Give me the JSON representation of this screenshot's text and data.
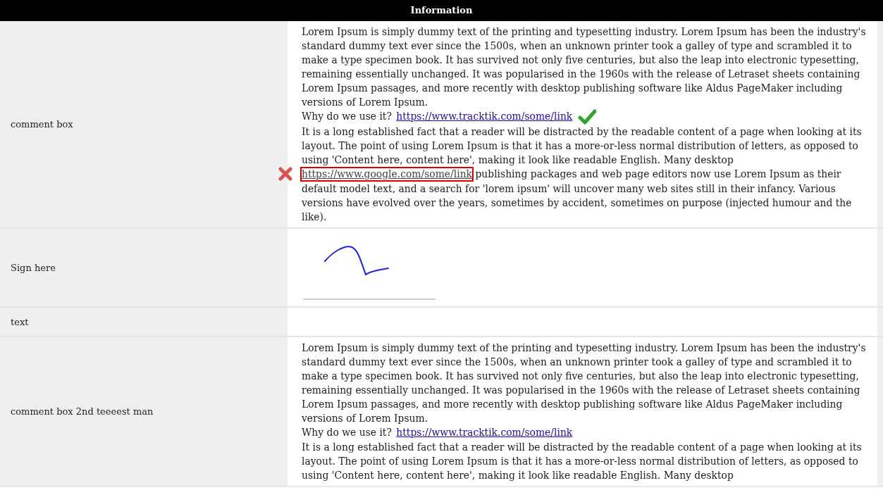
{
  "header": {
    "title": "Information"
  },
  "rows": [
    {
      "kind": "comment",
      "label": "comment box",
      "blocks": [
        [
          {
            "kind": "text",
            "text": "Lorem Ipsum is simply dummy text of the printing and typesetting industry. Lorem Ipsum has been the industry's standard dummy text ever since the 1500s, when an unknown printer took a galley of type and scrambled it to make a type specimen book. It has survived not only five centuries, but also the leap into electronic typesetting, remaining essentially unchanged. It was popularised in the 1960s with the release of Letraset sheets containing Lorem Ipsum passages, and more recently with desktop publishing software like Aldus PageMaker including versions of Lorem Ipsum."
          }
        ],
        [
          {
            "kind": "text",
            "text": "Why do we use it? "
          },
          {
            "kind": "link",
            "text": "https://www.tracktik.com/some/link",
            "verified": true,
            "flagged": false
          }
        ],
        [
          {
            "kind": "text",
            "text": "It is a long established fact that a reader will be distracted by the readable content of a page when looking at its layout. The point of using Lorem Ipsum is that it has a more-or-less normal distribution of letters, as opposed to using 'Content here, content here', making it look like readable English. Many desktop "
          },
          {
            "kind": "link",
            "text": "https://www.google.com/some/link",
            "verified": false,
            "flagged": true
          },
          {
            "kind": "text",
            "text": " publishing packages and web page editors now use Lorem Ipsum as their default model text, and a search for 'lorem ipsum' will uncover many web sites still in their infancy. Various versions have evolved over the years, sometimes by accident, sometimes on purpose (injected humour and the like)."
          }
        ]
      ]
    },
    {
      "kind": "signature",
      "label": "Sign here"
    },
    {
      "kind": "text",
      "label": "text"
    },
    {
      "kind": "comment",
      "label": "comment box 2nd teeeest man",
      "blocks": [
        [
          {
            "kind": "text",
            "text": "Lorem Ipsum is simply dummy text of the printing and typesetting industry. Lorem Ipsum has been the industry's standard dummy text ever since the 1500s, when an unknown printer took a galley of type and scrambled it to make a type specimen book. It has survived not only five centuries, but also the leap into electronic typesetting, remaining essentially unchanged. It was popularised in the 1960s with the release of Letraset sheets containing Lorem Ipsum passages, and more recently with desktop publishing software like Aldus PageMaker including versions of Lorem Ipsum."
          }
        ],
        [
          {
            "kind": "text",
            "text": "Why do we use it? "
          },
          {
            "kind": "link",
            "text": "https://www.tracktik.com/some/link",
            "verified": false,
            "flagged": false
          }
        ],
        [
          {
            "kind": "text",
            "text": "It is a long established fact that a reader will be distracted by the readable content of a page when looking at its layout. The point of using Lorem Ipsum is that it has a more-or-less normal distribution of letters, as opposed to using 'Content here, content here', making it look like readable English. Many desktop"
          }
        ]
      ]
    }
  ]
}
